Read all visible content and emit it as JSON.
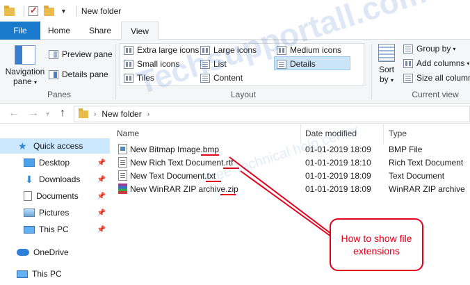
{
  "window": {
    "title": "New folder"
  },
  "tabs": [
    {
      "label": "File"
    },
    {
      "label": "Home"
    },
    {
      "label": "Share"
    },
    {
      "label": "View"
    }
  ],
  "ribbon": {
    "panes": {
      "navigation_pane": "Navigation pane",
      "navigation_pane_line1": "Navigation",
      "navigation_pane_line2": "pane",
      "preview_pane": "Preview pane",
      "details_pane": "Details pane",
      "group_label": "Panes"
    },
    "layout": {
      "extra_large_icons": "Extra large icons",
      "large_icons": "Large icons",
      "medium_icons": "Medium icons",
      "small_icons": "Small icons",
      "list": "List",
      "details": "Details",
      "tiles": "Tiles",
      "content": "Content",
      "group_label": "Layout",
      "selected": "Details"
    },
    "current_view": {
      "sort_by_line1": "Sort",
      "sort_by_line2": "by",
      "group_by": "Group by",
      "add_columns": "Add columns",
      "size_all_columns": "Size all column",
      "group_label": "Current view"
    }
  },
  "address": {
    "path": "New folder"
  },
  "sidebar": {
    "items": [
      {
        "label": "Quick access",
        "icon": "star-icon",
        "selected": true
      },
      {
        "label": "Desktop",
        "icon": "desktop-icon",
        "pinned": true
      },
      {
        "label": "Downloads",
        "icon": "download-icon",
        "pinned": true
      },
      {
        "label": "Documents",
        "icon": "documents-icon",
        "pinned": true
      },
      {
        "label": "Pictures",
        "icon": "pictures-icon",
        "pinned": true
      },
      {
        "label": "This PC",
        "icon": "pc-icon",
        "pinned": true
      },
      {
        "label": "OneDrive",
        "icon": "onedrive-icon"
      },
      {
        "label": "This PC",
        "icon": "pc-icon"
      }
    ]
  },
  "columns": {
    "name": "Name",
    "date_modified": "Date modified",
    "type": "Type"
  },
  "files": [
    {
      "name": "New Bitmap Image.bmp",
      "date": "01-01-2019 18:09",
      "type": "BMP File",
      "icon": "bmp-file-icon"
    },
    {
      "name": "New Rich Text Document.rtf",
      "date": "01-01-2019 18:10",
      "type": "Rich Text Document",
      "icon": "rtf-file-icon"
    },
    {
      "name": "New Text Document.txt",
      "date": "01-01-2019 18:09",
      "type": "Text Document",
      "icon": "txt-file-icon"
    },
    {
      "name": "New WinRAR ZIP archive.zip",
      "date": "01-01-2019 18:09",
      "type": "WinRAR ZIP archive",
      "icon": "zip-file-icon"
    }
  ],
  "annotation": {
    "callout_text": "How to show file extensions",
    "color": "#e3001b"
  },
  "watermark": {
    "main": "Techsupportall.com",
    "sub": "Free Technical help center"
  },
  "colors": {
    "file_tab": "#1979ca",
    "selection": "#cce8ff",
    "accent": "#e3001b"
  }
}
